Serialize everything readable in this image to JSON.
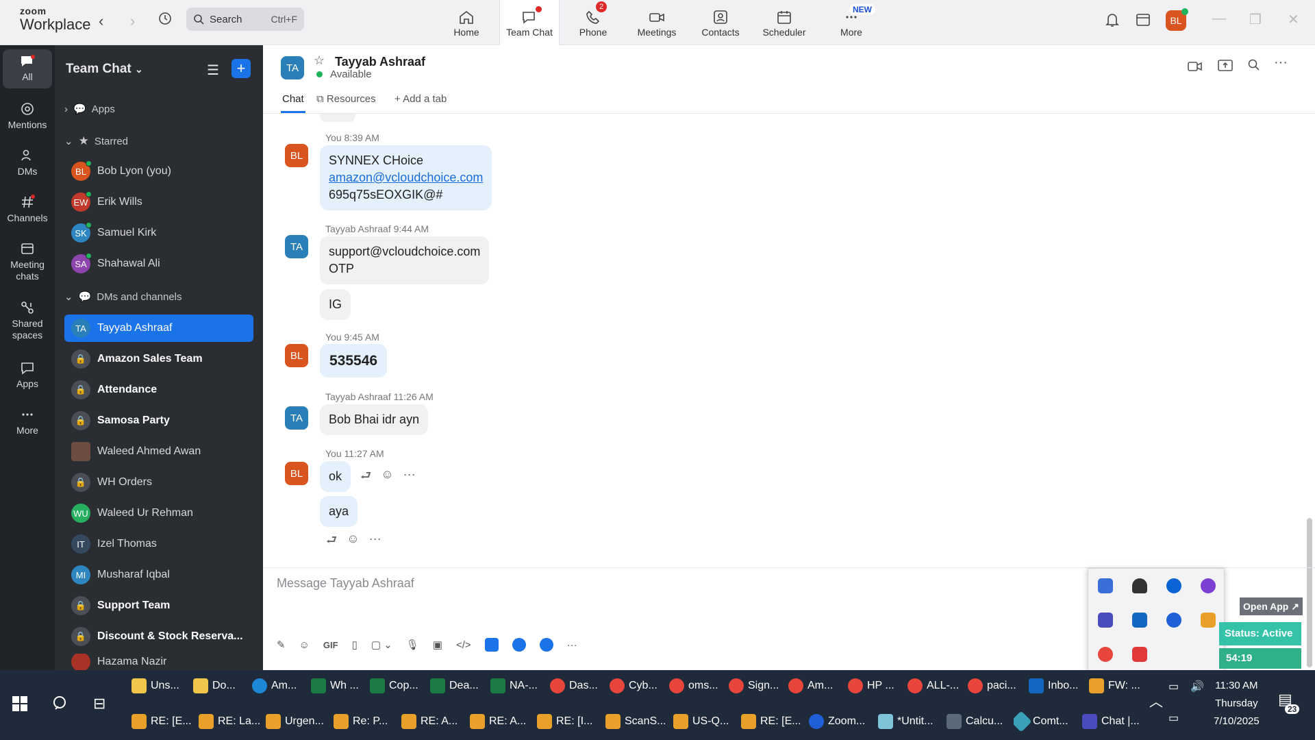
{
  "app": {
    "brand_top": "zoom",
    "brand_bottom": "Workplace"
  },
  "search": {
    "placeholder": "Search",
    "shortcut": "Ctrl+F"
  },
  "tabs": [
    {
      "label": "Home"
    },
    {
      "label": "Team Chat"
    },
    {
      "label": "Phone",
      "badge": "2"
    },
    {
      "label": "Meetings"
    },
    {
      "label": "Contacts"
    },
    {
      "label": "Scheduler"
    },
    {
      "label": "More",
      "badge": "NEW"
    }
  ],
  "user": {
    "initials": "BL",
    "color": "#d9541e"
  },
  "rail": [
    {
      "label": "All"
    },
    {
      "label": "Mentions"
    },
    {
      "label": "DMs"
    },
    {
      "label": "Channels"
    },
    {
      "label": "Meeting chats"
    },
    {
      "label": "Shared spaces"
    },
    {
      "label": "Apps"
    },
    {
      "label": "More"
    }
  ],
  "sidebar": {
    "title": "Team Chat",
    "apps_label": "Apps",
    "starred_label": "Starred",
    "dms_label": "DMs and channels",
    "starred": [
      {
        "initials": "BL",
        "name": "Bob Lyon (you)",
        "color": "#d9541e"
      },
      {
        "initials": "EW",
        "name": "Erik Wills",
        "color": "#c0392b"
      },
      {
        "initials": "SK",
        "name": "Samuel Kirk",
        "color": "#2e86c1"
      },
      {
        "initials": "SA",
        "name": "Shahawal Ali",
        "color": "#8e44ad"
      }
    ],
    "items": [
      {
        "initials": "TA",
        "name": "Tayyab Ashraaf",
        "color": "#2a7fb8"
      },
      {
        "name": "Amazon Sales Team"
      },
      {
        "name": "Attendance"
      },
      {
        "name": "Samosa Party"
      },
      {
        "initials": "",
        "name": "Waleed Ahmed Awan",
        "color": "#6d4c41"
      },
      {
        "name": "WH Orders"
      },
      {
        "initials": "WU",
        "name": "Waleed Ur Rehman",
        "color": "#27ae60"
      },
      {
        "initials": "IT",
        "name": "Izel Thomas",
        "color": "#34495e"
      },
      {
        "initials": "MI",
        "name": "Musharaf Iqbal",
        "color": "#2e86c1"
      },
      {
        "name": "Support Team"
      },
      {
        "name": "Discount & Stock Reserva..."
      },
      {
        "initials": "",
        "name": "Hazama Nazir",
        "color": "#a93226"
      }
    ]
  },
  "chat": {
    "contact": "Tayyab Ashraaf",
    "initials": "TA",
    "status": "Available",
    "tabs": {
      "chat": "Chat",
      "resources": "Resources",
      "add": "Add a tab"
    },
    "messages": [
      {
        "meta": "You 8:39 AM",
        "lines": [
          "SYNNEX CHoice",
          "amazon@vcloudchoice.com",
          "695q75sEOXGIK@#"
        ]
      },
      {
        "meta": "Tayyab Ashraaf 9:44 AM",
        "lines": [
          "support@vcloudchoice.com",
          "OTP",
          "IG"
        ]
      },
      {
        "meta": "You 9:45 AM",
        "lines": [
          "535546"
        ]
      },
      {
        "meta": "Tayyab Ashraaf 11:26 AM",
        "lines": [
          "Bob Bhai idr ayn"
        ]
      },
      {
        "meta": "You 11:27 AM",
        "lines": [
          "ok",
          "aya"
        ]
      }
    ],
    "composer_placeholder": "Message Tayyab Ashraaf",
    "gif": "GIF"
  },
  "overlay": {
    "open_app": "Open App ↗",
    "status": "Status: Active",
    "timer": "54:19"
  },
  "taskbar": {
    "row1": [
      "Uns...",
      "Do...",
      "Am...",
      "Wh ...",
      "Cop...",
      "Dea...",
      "NA-...",
      "Das...",
      "Cyb...",
      "oms...",
      "Sign...",
      "Am...",
      "HP ...",
      "ALL-...",
      "paci...",
      "Inbo...",
      "FW: ..."
    ],
    "row2": [
      "RE: [E...",
      "RE: La...",
      "Urgen...",
      "Re: P...",
      "RE: A...",
      "RE: A...",
      "RE: [I...",
      "ScanS...",
      "US-Q...",
      "RE: [E...",
      "Zoom...",
      "*Untit...",
      "Calcu...",
      "Comt...",
      "Chat |..."
    ],
    "time": "11:30 AM",
    "day": "Thursday",
    "date": "7/10/2025",
    "notif": "23"
  }
}
